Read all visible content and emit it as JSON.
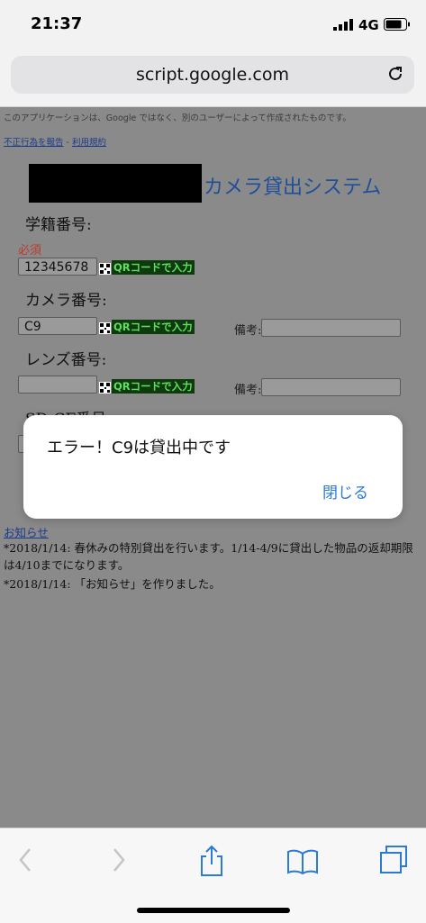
{
  "status": {
    "time": "21:37",
    "network": "4G"
  },
  "browser": {
    "url": "script.google.com"
  },
  "page": {
    "notice": "このアプリケーションは、Google ではなく、別のユーザーによって作成されたものです。",
    "report_link": "不正行為を報告",
    "separator": " - ",
    "terms_link": "利用規約",
    "system_title": "カメラ貸出システム",
    "student_label": "学籍番号:",
    "required": "必須",
    "student_value": "12345678",
    "qr_button": "QRコードで入力",
    "camera_label": "カメラ番号:",
    "camera_value": "C9",
    "biko_label": "備考:",
    "lens_label": "レンズ番号:",
    "sd_label": "SD-CF番号:",
    "news_link": "お知らせ",
    "news": [
      "*2018/1/14: 春休みの特別貸出を行います。1/14-4/9に貸出した物品の返却期限は4/10までになります。",
      "*2018/1/14: 「お知らせ」を作りました。"
    ]
  },
  "alert": {
    "message": "エラー！C9は貸出中です",
    "close_label": "閉じる"
  },
  "colors": {
    "link": "#2a7ad8",
    "title": "#1f4f9a",
    "qr_text": "#5fe05f"
  }
}
